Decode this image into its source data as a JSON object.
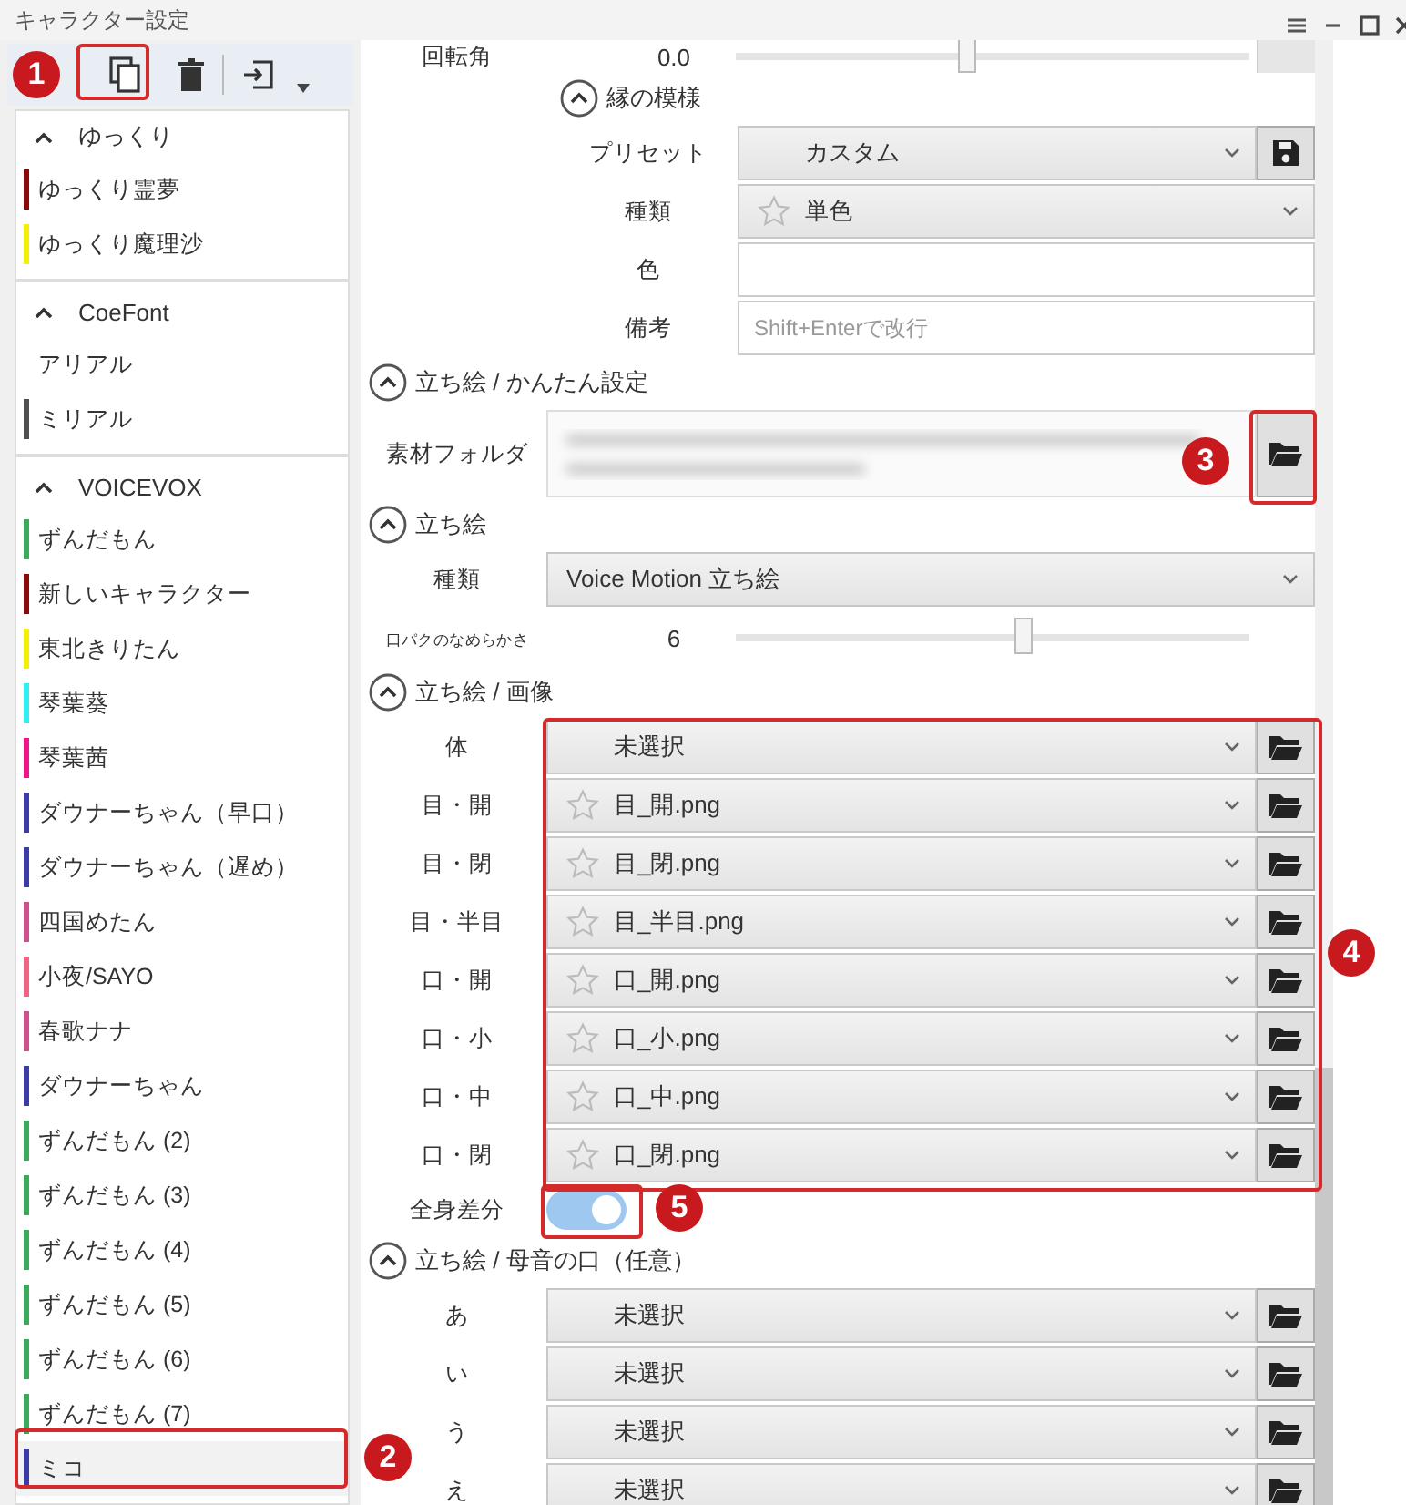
{
  "window": {
    "title": "キャラクター設定"
  },
  "character_groups": [
    {
      "name": "ゆっくり",
      "expanded": true,
      "characters": [
        {
          "name": "ゆっくり霊夢",
          "color": "#8b0a0a",
          "selected": false
        },
        {
          "name": "ゆっくり魔理沙",
          "color": "#f5f000",
          "selected": false
        }
      ]
    },
    {
      "name": "CoeFont",
      "expanded": true,
      "characters": [
        {
          "name": "アリアル",
          "selected": false
        },
        {
          "name": "ミリアル",
          "color": "#505050",
          "selected": false
        }
      ]
    },
    {
      "name": "VOICEVOX",
      "expanded": true,
      "characters": [
        {
          "name": "ずんだもん",
          "color": "#3aaa5c",
          "selected": false
        },
        {
          "name": "新しいキャラクター",
          "color": "#8b0a0a",
          "selected": false
        },
        {
          "name": "東北きりたん",
          "color": "#f5f000",
          "selected": false
        },
        {
          "name": "琴葉葵",
          "color": "#2ef0f0",
          "selected": false
        },
        {
          "name": "琴葉茜",
          "color": "#f0158a",
          "selected": false
        },
        {
          "name": "ダウナーちゃん（早口）",
          "color": "#3c3ca8",
          "selected": false
        },
        {
          "name": "ダウナーちゃん（遅め）",
          "color": "#3c3ca8",
          "selected": false
        },
        {
          "name": "四国めたん",
          "color": "#d0508c",
          "selected": false
        },
        {
          "name": "小夜/SAYO",
          "color": "#f06482",
          "selected": false
        },
        {
          "name": "春歌ナナ",
          "color": "#d0508c",
          "selected": false
        },
        {
          "name": "ダウナーちゃん",
          "color": "#3c3ca8",
          "selected": false
        },
        {
          "name": "ずんだもん (2)",
          "color": "#3aaa5c",
          "selected": false
        },
        {
          "name": "ずんだもん (3)",
          "color": "#3aaa5c",
          "selected": false
        },
        {
          "name": "ずんだもん (4)",
          "color": "#3aaa5c",
          "selected": false
        },
        {
          "name": "ずんだもん (5)",
          "color": "#3aaa5c",
          "selected": false
        },
        {
          "name": "ずんだもん (6)",
          "color": "#3aaa5c",
          "selected": false
        },
        {
          "name": "ずんだもん (7)",
          "color": "#3aaa5c",
          "selected": false
        },
        {
          "name": "ミコ",
          "color": "#3c3ca8",
          "selected": true
        }
      ]
    }
  ],
  "rotation_row": {
    "label": "回転角",
    "reading": "0.0",
    "level": 0.45
  },
  "sections": [
    {
      "title": "縁の模様",
      "expanded": true,
      "nested": true,
      "rows": [
        {
          "kind": "select",
          "label": "プリセット",
          "value": "カスタム",
          "save_button": true
        },
        {
          "kind": "select",
          "label": "種類",
          "value": "単色",
          "favorite": false
        },
        {
          "kind": "text",
          "label": "色"
        },
        {
          "kind": "text",
          "label": "備考",
          "placeholder": "Shift+Enterで改行"
        }
      ]
    },
    {
      "title": "立ち絵 / かんたん設定",
      "expanded": true,
      "nested": false,
      "rows": [
        {
          "kind": "folder",
          "label": "素材フォルダ"
        }
      ]
    },
    {
      "title": "立ち絵",
      "expanded": true,
      "nested": false,
      "rows": [
        {
          "kind": "select",
          "label": "種類",
          "value": "Voice Motion 立ち絵",
          "plain": true
        },
        {
          "kind": "slider",
          "label": "口パクのなめらかさ",
          "reading": "6",
          "level": 0.56
        }
      ]
    },
    {
      "title": "立ち絵 / 画像",
      "expanded": true,
      "nested": false,
      "rows": [
        {
          "kind": "file",
          "label": "体",
          "value": "未選択"
        },
        {
          "kind": "file",
          "label": "目・開",
          "value": "目_開.png",
          "favorite": false
        },
        {
          "kind": "file",
          "label": "目・閉",
          "value": "目_閉.png",
          "favorite": false
        },
        {
          "kind": "file",
          "label": "目・半目",
          "value": "目_半目.png",
          "favorite": false
        },
        {
          "kind": "file",
          "label": "口・開",
          "value": "口_開.png",
          "favorite": false
        },
        {
          "kind": "file",
          "label": "口・小",
          "value": "口_小.png",
          "favorite": false
        },
        {
          "kind": "file",
          "label": "口・中",
          "value": "口_中.png",
          "favorite": false
        },
        {
          "kind": "file",
          "label": "口・閉",
          "value": "口_閉.png",
          "favorite": false
        },
        {
          "kind": "toggle",
          "label": "全身差分",
          "on": true
        }
      ]
    },
    {
      "title": "立ち絵 / 母音の口（任意）",
      "expanded": true,
      "nested": false,
      "rows": [
        {
          "kind": "file",
          "label": "あ",
          "value": "未選択"
        },
        {
          "kind": "file",
          "label": "い",
          "value": "未選択"
        },
        {
          "kind": "file",
          "label": "う",
          "value": "未選択"
        },
        {
          "kind": "file",
          "label": "え",
          "value": "未選択"
        }
      ]
    }
  ],
  "annotations": [
    {
      "number": "1"
    },
    {
      "number": "2"
    },
    {
      "number": "3"
    },
    {
      "number": "4"
    },
    {
      "number": "5"
    }
  ]
}
